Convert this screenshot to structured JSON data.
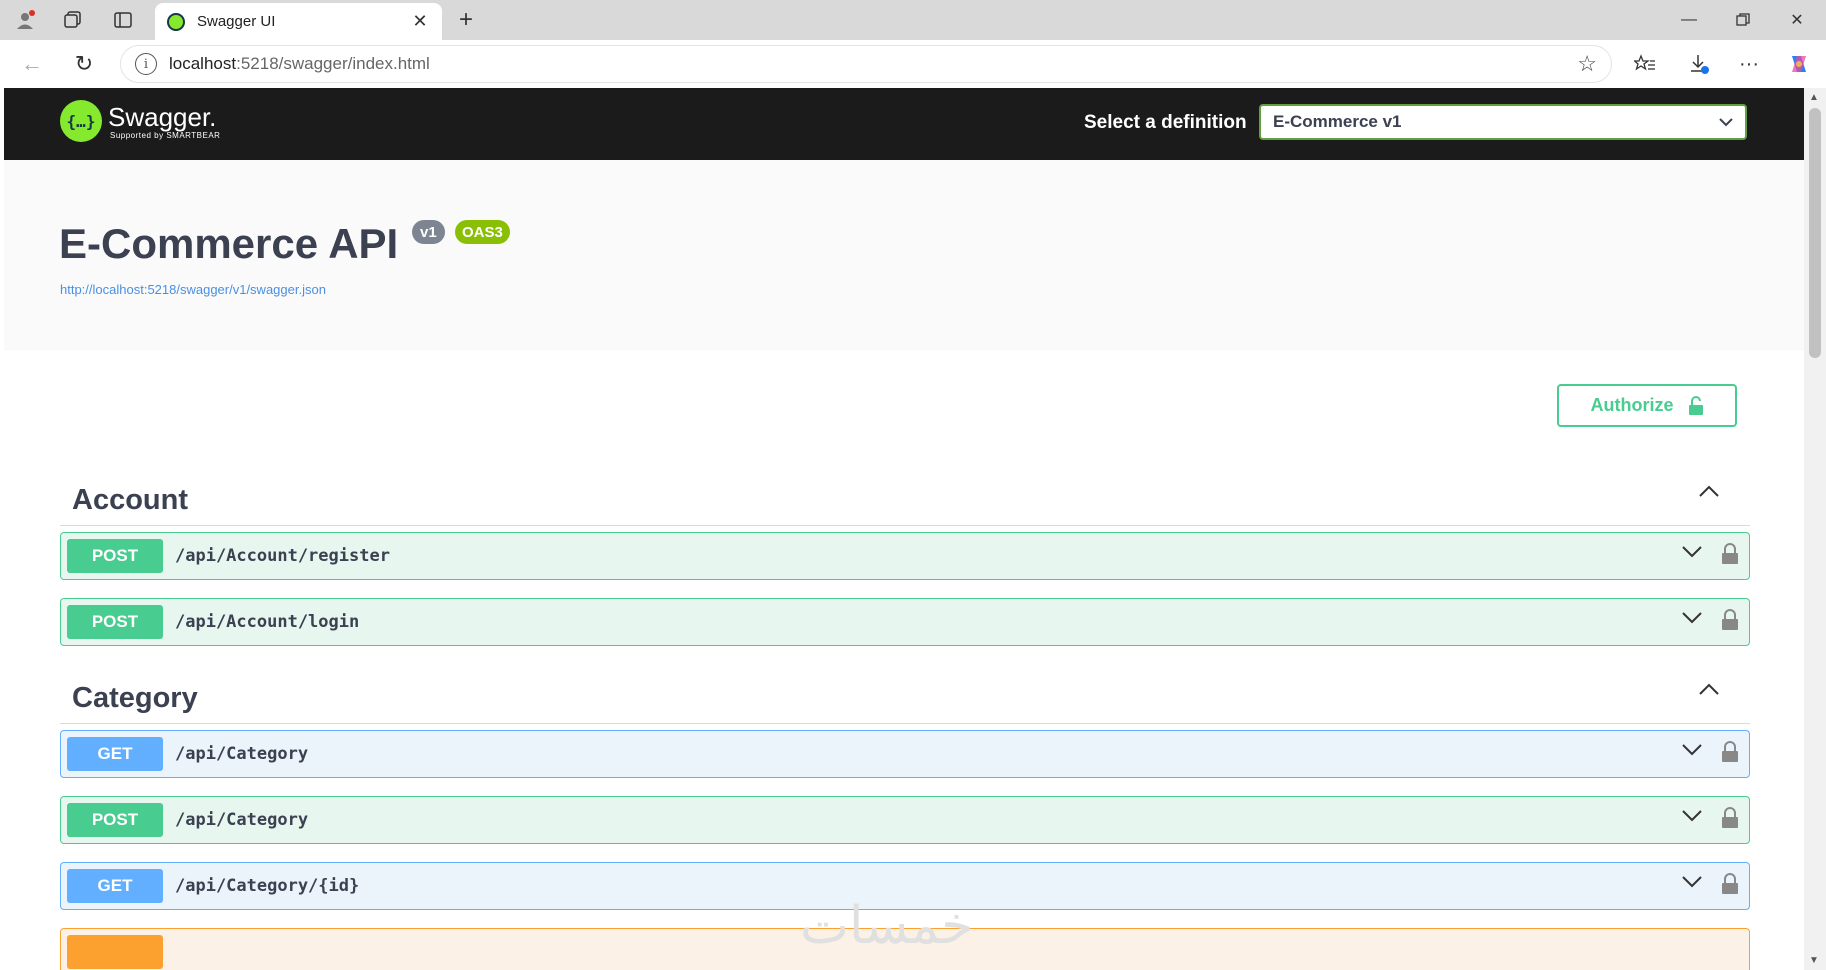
{
  "browser": {
    "tab_title": "Swagger UI",
    "url_host": "localhost",
    "url_rest": ":5218/swagger/index.html"
  },
  "topbar": {
    "logo_name": "Swagger.",
    "logo_sub": "Supported by SMARTBEAR",
    "definition_label": "Select a definition",
    "definition_value": "E-Commerce v1"
  },
  "info": {
    "title": "E-Commerce API",
    "version_badge": "v1",
    "oas_badge": "OAS3",
    "spec_url": "http://localhost:5218/swagger/v1/swagger.json"
  },
  "auth": {
    "authorize_label": "Authorize"
  },
  "tags": [
    {
      "name": "Account"
    },
    {
      "name": "Category"
    }
  ],
  "operations": [
    {
      "method": "POST",
      "path": "/api/Account/register"
    },
    {
      "method": "POST",
      "path": "/api/Account/login"
    },
    {
      "method": "GET",
      "path": "/api/Category"
    },
    {
      "method": "POST",
      "path": "/api/Category"
    },
    {
      "method": "GET",
      "path": "/api/Category/{id}"
    },
    {
      "method": "",
      "path": ""
    }
  ],
  "watermark": "خمسات",
  "colors": {
    "post": "#49cc90",
    "get": "#61affe",
    "put": "#fca130",
    "swagger_green": "#85ea2d",
    "topbar": "#1b1b1b"
  }
}
